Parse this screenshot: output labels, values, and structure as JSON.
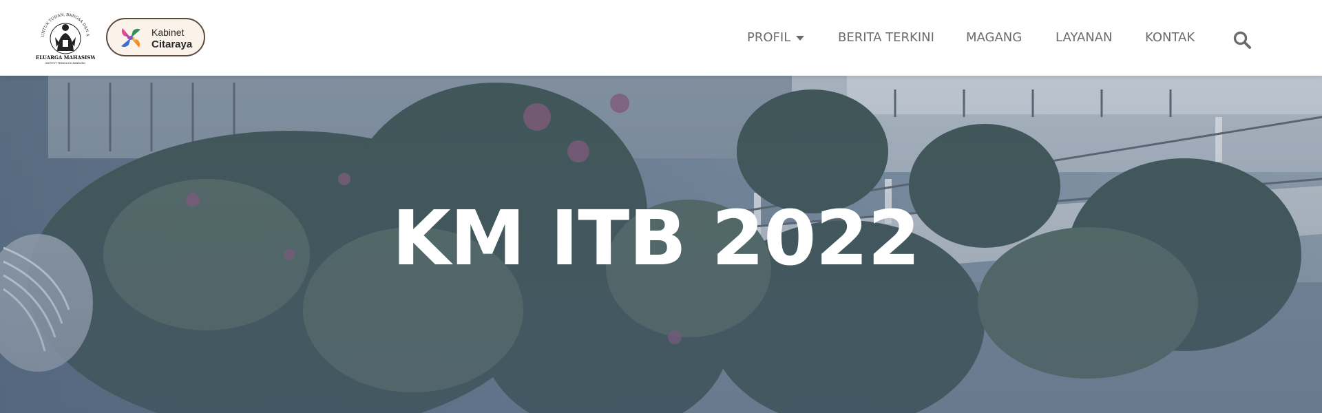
{
  "header": {
    "logo_km": {
      "icon": "km-itb-logo-icon",
      "ring_text": "UNTUK TUHAN, BANGSA DAN ALMAMATER",
      "org_name": "KELUARGA MAHASISWA",
      "institution": "INSTITUT TEKNOLOGI BANDUNG"
    },
    "cabinet_badge": {
      "icon": "citaraya-logo-icon",
      "line1": "Kabinet",
      "line2": "Citaraya"
    }
  },
  "nav": {
    "items": [
      {
        "label": "PROFIL",
        "has_dropdown": true
      },
      {
        "label": "BERITA TERKINI"
      },
      {
        "label": "MAGANG"
      },
      {
        "label": "LAYANAN"
      },
      {
        "label": "KONTAK"
      }
    ],
    "search_icon": "search-icon"
  },
  "hero": {
    "title": "KM ITB 2022",
    "background": "campus building with greenery photo"
  },
  "colors": {
    "nav_text": "#6b6b6b",
    "hero_overlay": "#4a5d78",
    "badge_bg": "#fbf2e9",
    "badge_border": "#5b4a3f"
  }
}
